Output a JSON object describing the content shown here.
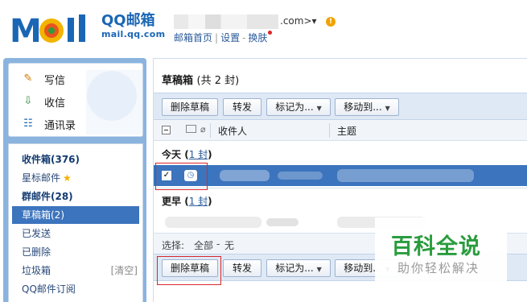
{
  "header": {
    "brand_name": "QQ邮箱",
    "brand_url": "mail.qq.com",
    "account_suffix": ".com>▾",
    "links": [
      "邮箱首页",
      "设置",
      "换肤"
    ]
  },
  "sidebar": {
    "compose": [
      {
        "label": "写信",
        "icon": "pen-icon"
      },
      {
        "label": "收信",
        "icon": "inbox-download-icon"
      },
      {
        "label": "通讯录",
        "icon": "contacts-icon"
      }
    ],
    "folders": [
      {
        "label": "收件箱(376)",
        "bold": true
      },
      {
        "label": "星标邮件",
        "star": "★"
      },
      {
        "label": "群邮件(28)",
        "bold": true
      },
      {
        "label": "草稿箱(2)",
        "active": true
      },
      {
        "label": "已发送"
      },
      {
        "label": "已删除"
      },
      {
        "label": "垃圾箱",
        "extra": "[清空]"
      },
      {
        "label": "QQ邮件订阅"
      }
    ]
  },
  "main": {
    "title": "草稿箱",
    "title_count": "(共 2 封)",
    "toolbar": {
      "delete": "删除草稿",
      "forward": "转发",
      "mark": "标记为...",
      "move": "移动到..."
    },
    "columns": {
      "recipient": "收件人",
      "subject": "主题"
    },
    "groups": [
      {
        "label": "今天",
        "count": "1 封"
      },
      {
        "label": "更早",
        "count": "1 封"
      }
    ],
    "select_bar": {
      "label": "选择:",
      "all": "全部",
      "dash": "-",
      "none": "无"
    },
    "bottom_toolbar": {
      "delete": "删除草稿",
      "forward": "转发",
      "mark": "标记为...",
      "move": "移动到..."
    }
  },
  "watermark": {
    "title": "百科全说",
    "subtitle": "助你轻松解决"
  },
  "colors": {
    "accent": "#3c74bd",
    "sidebar_bg": "#8ab4de",
    "brand": "#1a66b5",
    "highlight": "#d8282b",
    "watermark": "#2a9c3e"
  }
}
